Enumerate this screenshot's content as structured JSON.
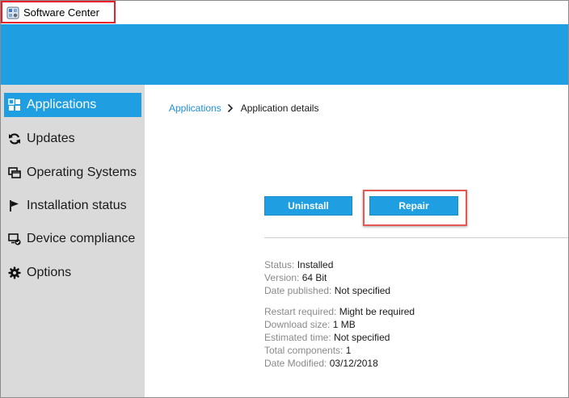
{
  "window": {
    "title": "Software Center",
    "icon": "software-center-icon"
  },
  "colors": {
    "accent": "#1f9ee1",
    "sidebar_bg": "#dadada",
    "highlight": "#e8202a",
    "link": "#1f8fd4"
  },
  "sidebar": {
    "items": [
      {
        "label": "Applications",
        "icon": "applications-icon",
        "active": true
      },
      {
        "label": "Updates",
        "icon": "refresh-icon",
        "active": false
      },
      {
        "label": "Operating Systems",
        "icon": "operating-systems-icon",
        "active": false
      },
      {
        "label": "Installation status",
        "icon": "flag-icon",
        "active": false
      },
      {
        "label": "Device compliance",
        "icon": "device-compliance-icon",
        "active": false
      },
      {
        "label": "Options",
        "icon": "gear-icon",
        "active": false
      }
    ]
  },
  "breadcrumb": {
    "parent": "Applications",
    "current": "Application details"
  },
  "actions": {
    "uninstall_label": "Uninstall",
    "repair_label": "Repair"
  },
  "details": {
    "group1": [
      {
        "label": "Status:",
        "value": "Installed"
      },
      {
        "label": "Version:",
        "value": "64 Bit"
      },
      {
        "label": "Date published:",
        "value": "Not specified"
      }
    ],
    "group2": [
      {
        "label": "Restart required:",
        "value": "Might be required"
      },
      {
        "label": "Download size:",
        "value": "1 MB"
      },
      {
        "label": "Estimated time:",
        "value": "Not specified"
      },
      {
        "label": "Total components:",
        "value": "1"
      },
      {
        "label": "Date Modified:",
        "value": "03/12/2018"
      }
    ]
  }
}
